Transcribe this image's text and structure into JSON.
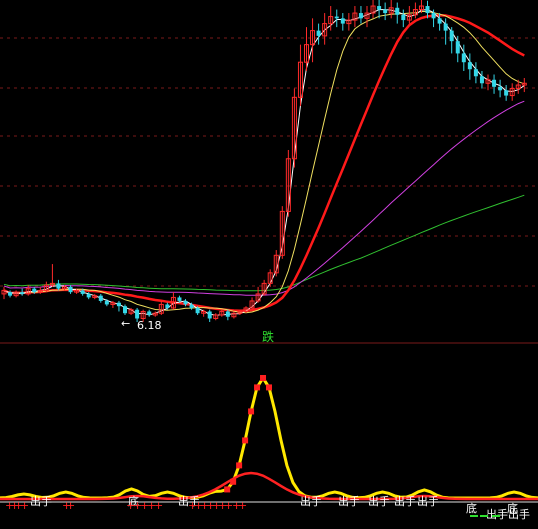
{
  "chart_data": [
    {
      "type": "candlestick",
      "title": "",
      "low_annotation": "6.18",
      "colors": {
        "up": "#ff2a2a",
        "down": "#35d7e8",
        "ma_short": "#ffffff",
        "ma_mid": "#f0e060",
        "ma_red": "#ff1a1a",
        "ma_purple": "#d040e0",
        "ma_green": "#30c030"
      },
      "candles": [
        [
          8,
          10,
          5,
          12
        ],
        [
          9,
          7,
          6,
          10
        ],
        [
          7,
          9,
          6,
          10
        ],
        [
          9,
          8,
          7,
          11
        ],
        [
          8,
          11,
          7,
          13
        ],
        [
          11,
          9,
          8,
          12
        ],
        [
          9,
          10,
          8,
          12
        ],
        [
          10,
          13,
          9,
          15
        ],
        [
          13,
          14,
          12,
          25
        ],
        [
          14,
          11,
          10,
          16
        ],
        [
          11,
          12,
          10,
          13
        ],
        [
          12,
          9,
          8,
          13
        ],
        [
          9,
          10,
          8,
          11
        ],
        [
          10,
          8,
          7,
          11
        ],
        [
          8,
          6,
          5,
          9
        ],
        [
          6,
          7,
          5,
          8
        ],
        [
          7,
          4,
          3,
          8
        ],
        [
          4,
          2,
          1,
          5
        ],
        [
          2,
          3,
          0,
          4
        ],
        [
          3,
          1,
          -2,
          4
        ],
        [
          1,
          -3,
          -4,
          2
        ],
        [
          -3,
          -1,
          -4,
          0
        ],
        [
          -1,
          -6,
          -8,
          0
        ],
        [
          -6,
          -2,
          -8,
          -1
        ],
        [
          -2,
          -4,
          -5,
          -1
        ],
        [
          -4,
          -3,
          -5,
          -2
        ],
        [
          -3,
          2,
          -4,
          4
        ],
        [
          2,
          0,
          -1,
          3
        ],
        [
          0,
          6,
          -1,
          9
        ],
        [
          6,
          4,
          3,
          7
        ],
        [
          4,
          2,
          1,
          5
        ],
        [
          2,
          0,
          -1,
          3
        ],
        [
          0,
          -3,
          -4,
          1
        ],
        [
          -3,
          -2,
          -5,
          -1
        ],
        [
          -2,
          -6,
          -8,
          -1
        ],
        [
          -6,
          -4,
          -7,
          -3
        ],
        [
          -4,
          -2,
          -5,
          -1
        ],
        [
          -2,
          -5,
          -7,
          -1
        ],
        [
          -5,
          -3,
          -6,
          -2
        ],
        [
          -3,
          -2,
          -4,
          -1
        ],
        [
          -2,
          0,
          -3,
          1
        ],
        [
          0,
          4,
          -1,
          6
        ],
        [
          4,
          8,
          3,
          12
        ],
        [
          8,
          14,
          7,
          16
        ],
        [
          14,
          20,
          12,
          22
        ],
        [
          20,
          30,
          18,
          33
        ],
        [
          30,
          55,
          28,
          58
        ],
        [
          55,
          85,
          52,
          90
        ],
        [
          85,
          120,
          80,
          125
        ],
        [
          120,
          140,
          115,
          150
        ],
        [
          140,
          150,
          135,
          160
        ],
        [
          150,
          158,
          140,
          165
        ],
        [
          158,
          155,
          150,
          162
        ],
        [
          155,
          162,
          150,
          168
        ],
        [
          162,
          166,
          158,
          172
        ],
        [
          166,
          165,
          160,
          170
        ],
        [
          165,
          162,
          158,
          168
        ],
        [
          162,
          164,
          158,
          168
        ],
        [
          164,
          168,
          160,
          172
        ],
        [
          168,
          165,
          162,
          172
        ],
        [
          165,
          168,
          160,
          172
        ],
        [
          168,
          172,
          165,
          176
        ],
        [
          172,
          170,
          165,
          176
        ],
        [
          170,
          168,
          164,
          174
        ],
        [
          168,
          171,
          165,
          176
        ],
        [
          171,
          167,
          162,
          174
        ],
        [
          167,
          164,
          160,
          170
        ],
        [
          164,
          167,
          162,
          172
        ],
        [
          167,
          170,
          165,
          174
        ],
        [
          170,
          172,
          168,
          176
        ],
        [
          172,
          168,
          165,
          175
        ],
        [
          168,
          165,
          160,
          170
        ],
        [
          165,
          162,
          158,
          168
        ],
        [
          162,
          158,
          150,
          165
        ],
        [
          158,
          152,
          145,
          160
        ],
        [
          152,
          145,
          140,
          155
        ],
        [
          145,
          140,
          135,
          150
        ],
        [
          140,
          136,
          130,
          145
        ],
        [
          136,
          132,
          128,
          140
        ],
        [
          132,
          128,
          125,
          135
        ],
        [
          128,
          130,
          124,
          133
        ],
        [
          130,
          126,
          122,
          133
        ],
        [
          126,
          124,
          120,
          130
        ],
        [
          124,
          121,
          118,
          127
        ],
        [
          121,
          125,
          118,
          128
        ],
        [
          125,
          127,
          122,
          130
        ],
        [
          127,
          128,
          123,
          131
        ]
      ]
    },
    {
      "type": "indicator",
      "label_top": "跌",
      "marker_text": "出手",
      "marker_text_alt": "底",
      "buy_marker": "+",
      "colors": {
        "line_yellow": "#ffe800",
        "line_red": "#ff2222",
        "line_white": "#e0e0e0",
        "marker_white": "#ffffff",
        "marker_red": "#ff2020",
        "marker_green": "#30e030"
      }
    }
  ]
}
